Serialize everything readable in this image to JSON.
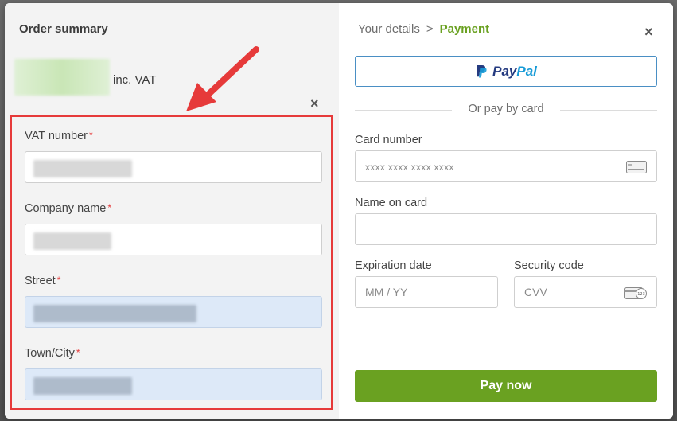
{
  "order": {
    "title": "Order summary",
    "vat_suffix": "inc. VAT"
  },
  "billing_form": {
    "required_marker": "*",
    "fields": [
      {
        "label": "VAT number"
      },
      {
        "label": "Company name"
      },
      {
        "label": "Street"
      },
      {
        "label": "Town/City"
      }
    ]
  },
  "breadcrumb": {
    "step1": "Your details",
    "separator": ">",
    "step2": "Payment"
  },
  "close_glyph": "×",
  "paypal": {
    "pay": "Pay",
    "pal": "Pal"
  },
  "divider_text": "Or pay by card",
  "card": {
    "number_label": "Card number",
    "number_placeholder": "xxxx xxxx xxxx xxxx",
    "name_label": "Name on card",
    "expiry_label": "Expiration date",
    "expiry_placeholder": "MM / YY",
    "security_label": "Security code",
    "security_placeholder": "CVV"
  },
  "pay_button": "Pay now",
  "colors": {
    "accent_green": "#6aa121",
    "highlight_red": "#e63a3a",
    "paypal_dark": "#253b80",
    "paypal_light": "#179bd7"
  },
  "icons": [
    "arrow-annotation-icon",
    "paypal-icon",
    "card-icon",
    "cvv-card-icon",
    "close-icon"
  ]
}
